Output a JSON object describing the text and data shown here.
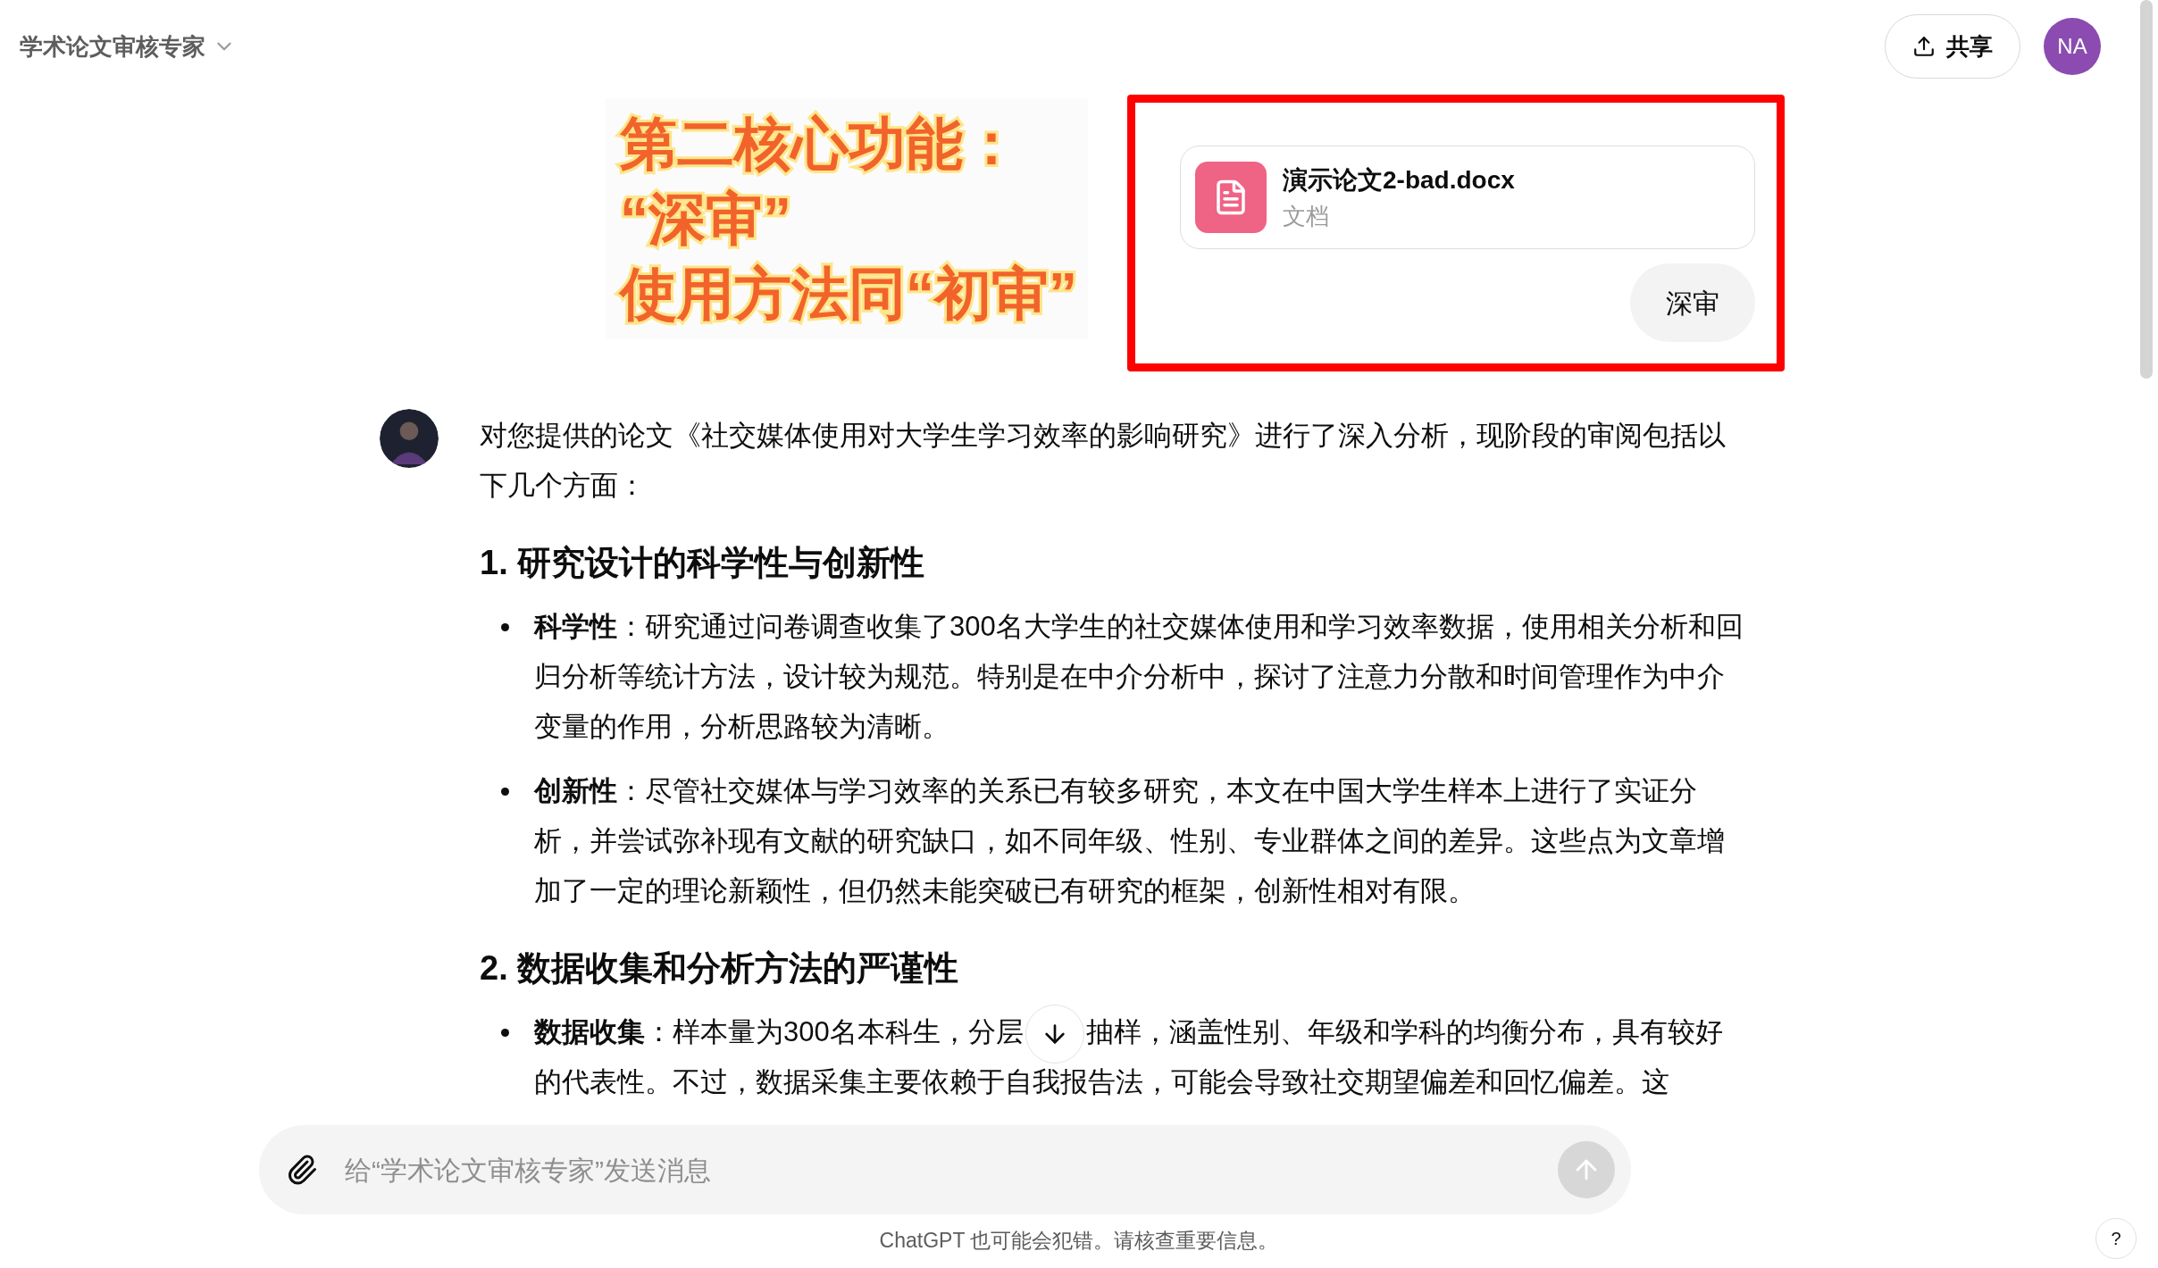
{
  "header": {
    "title": "学术论文审核专家",
    "share_label": "共享",
    "user_initials": "NA"
  },
  "annotation": {
    "lines": [
      "第二核心功能：",
      "“深审”",
      "使用方法同“初审”"
    ]
  },
  "upload": {
    "file_name": "演示论文2-bad.docx",
    "file_type": "文档",
    "message": "深审"
  },
  "reply": {
    "intro": "对您提供的论文《社交媒体使用对大学生学习效率的影响研究》进行了深入分析，现阶段的审阅包括以下几个方面：",
    "sections": [
      {
        "heading": "1. 研究设计的科学性与创新性",
        "bullets": [
          {
            "term": "科学性",
            "text": "：研究通过问卷调查收集了300名大学生的社交媒体使用和学习效率数据，使用相关分析和回归分析等统计方法，设计较为规范。特别是在中介分析中，探讨了注意力分散和时间管理作为中介变量的作用，分析思路较为清晰。"
          },
          {
            "term": "创新性",
            "text": "：尽管社交媒体与学习效率的关系已有较多研究，本文在中国大学生样本上进行了实证分析，并尝试弥补现有文献的研究缺口，如不同年级、性别、专业群体之间的差异。这些点为文章增加了一定的理论新颖性，但仍然未能突破已有研究的框架，创新性相对有限。"
          }
        ]
      },
      {
        "heading": "2. 数据收集和分析方法的严谨性",
        "bullets": [
          {
            "term": "数据收集",
            "text": "：样本量为300名本科生，分层",
            "text_after": "抽样，涵盖性别、年级和学科的均衡分布，具有较好的代表性。不过，数据采集主要依赖于自我报告法，可能会导致社交期望偏差和回忆偏差。这"
          }
        ]
      }
    ]
  },
  "composer": {
    "placeholder": "给“学术论文审核专家”发送消息"
  },
  "disclaimer": "ChatGPT 也可能会犯错。请核查重要信息。",
  "help_label": "?"
}
